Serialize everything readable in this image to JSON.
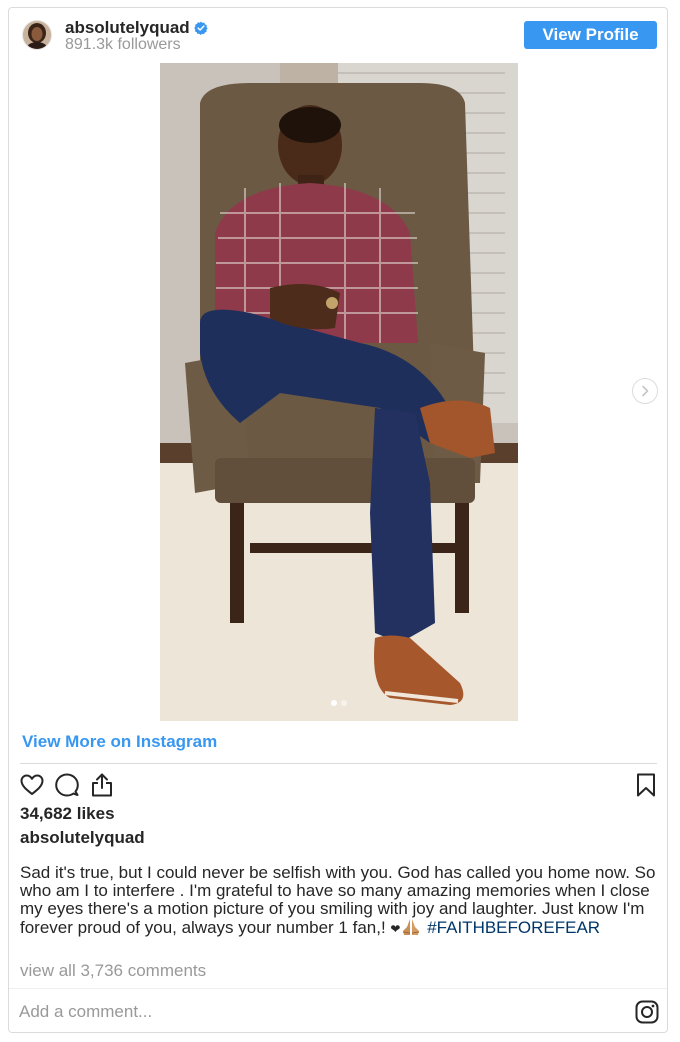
{
  "header": {
    "username": "absolutelyquad",
    "followers": "891.3k followers",
    "view_profile_label": "View Profile",
    "verified_icon": "verified-badge-icon"
  },
  "media": {
    "carousel_dots": 2,
    "active_dot": 1
  },
  "view_more_label": "View More on Instagram",
  "actions": {
    "icons": [
      "heart-icon",
      "comment-icon",
      "share-icon",
      "bookmark-icon"
    ]
  },
  "likes": "34,682 likes",
  "owner": "absolutelyquad",
  "caption": {
    "text": "Sad it's true, but I could never be selfish with you. God has called you home now. So who am I to interfere . I'm grateful to have so many amazing memories when I close my eyes there's a motion picture of you smiling with  joy and laughter. Just know I'm forever proud of you, always your number 1 fan,! ",
    "heart": "❤",
    "hashtag": "#FAITHBEFOREFEAR"
  },
  "comments_link": "view all 3,736 comments",
  "comment_placeholder": "Add a comment...",
  "colors": {
    "accent": "#3897f0",
    "hashtag": "#003569",
    "muted": "#999999",
    "text": "#262626"
  }
}
